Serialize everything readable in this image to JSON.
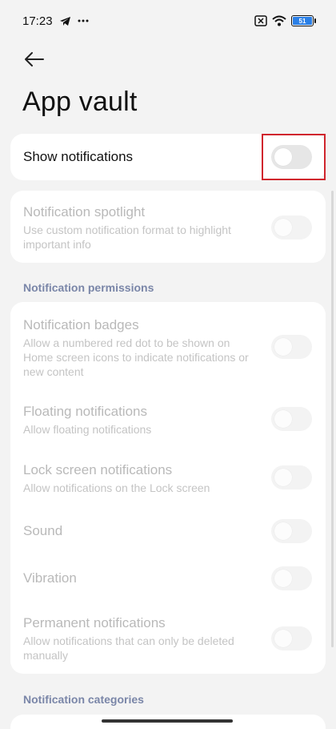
{
  "status_bar": {
    "time": "17:23",
    "icons": [
      "telegram-icon",
      "dots-icon",
      "sim-no-signal-icon",
      "wifi-icon",
      "battery-icon"
    ],
    "battery_level": "51"
  },
  "header": {
    "back_icon": "back-arrow-icon",
    "title": "App vault"
  },
  "top_setting": {
    "label": "Show notifications",
    "enabled": false
  },
  "spotlight": {
    "title": "Notification spotlight",
    "subtitle": "Use custom notification format to highlight important info"
  },
  "permissions": {
    "header": "Notification permissions",
    "items": [
      {
        "title": "Notification badges",
        "subtitle": "Allow a numbered red dot to be shown on Home screen icons to indicate notifications or new content"
      },
      {
        "title": "Floating notifications",
        "subtitle": "Allow floating notifications"
      },
      {
        "title": "Lock screen notifications",
        "subtitle": "Allow notifications on the Lock screen"
      },
      {
        "title": "Sound",
        "subtitle": ""
      },
      {
        "title": "Vibration",
        "subtitle": ""
      },
      {
        "title": "Permanent notifications",
        "subtitle": "Allow notifications that can only be deleted manually"
      }
    ]
  },
  "categories": {
    "header": "Notification categories"
  },
  "colors": {
    "highlight": "#d0252d",
    "section_header": "#7a86a8",
    "disabled_text": "#b9b9b9"
  }
}
